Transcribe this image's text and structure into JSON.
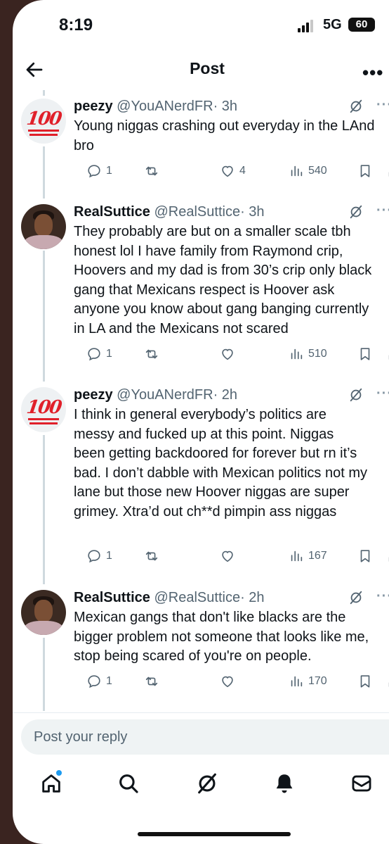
{
  "status_bar": {
    "time": "8:19",
    "network": "5G",
    "battery": "60"
  },
  "header": {
    "title": "Post",
    "back_icon": "arrow-left-icon",
    "more_icon": "more-icon"
  },
  "tweets": [
    {
      "name": "peezy",
      "handle": "@YouANerdFR",
      "time": "· 3h",
      "avatar": "100-emoji",
      "text": "Young niggas crashing out everyday in the LAnd bro",
      "replies": "1",
      "reposts": "",
      "likes": "4",
      "views": "540"
    },
    {
      "name": "RealSuttice",
      "handle": "@RealSuttice",
      "time": "· 3h",
      "avatar": "photo",
      "text": "They probably are but on a smaller scale tbh honest lol I have family from Raymond crip, Hoovers and my dad is from 30’s crip only black gang that Mexicans respect is Hoover ask anyone you know about gang banging currently in LA and the Mexicans not scared",
      "replies": "1",
      "reposts": "",
      "likes": "",
      "views": "510"
    },
    {
      "name": "peezy",
      "handle": "@YouANerdFR",
      "time": "· 2h",
      "avatar": "100-emoji",
      "text": "I think in general everybody’s politics are messy and fucked up at this point. Niggas been getting backdoored for forever but rn it’s bad. I don’t dabble with Mexican politics not my lane but those new Hoover niggas are super grimey. Xtra’d out ch**d pimpin ass niggas",
      "replies": "1",
      "reposts": "",
      "likes": "",
      "views": "167"
    },
    {
      "name": "RealSuttice",
      "handle": "@RealSuttice",
      "time": "· 2h",
      "avatar": "photo",
      "text": "Mexican gangs that don't like blacks are the bigger problem not someone that looks like me, stop being scared of you're on people.",
      "replies": "1",
      "reposts": "",
      "likes": "",
      "views": "170"
    }
  ],
  "reply_box": {
    "placeholder": "Post your reply"
  },
  "tab_bar": [
    "home-icon",
    "search-icon",
    "grok-icon",
    "notifications-icon",
    "messages-icon"
  ],
  "colors": {
    "accent": "#1d9bf0",
    "muted": "#536471",
    "text": "#0f1419"
  }
}
